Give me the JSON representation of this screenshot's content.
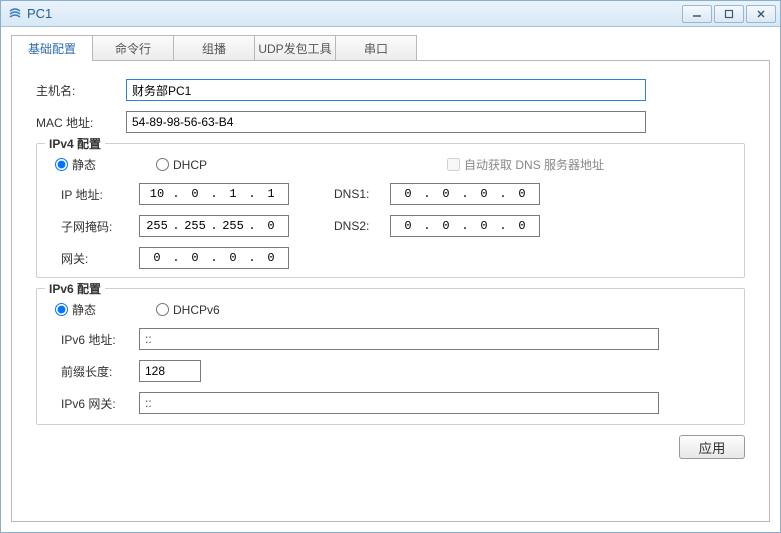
{
  "window": {
    "title": "PC1"
  },
  "tabs": [
    "基础配置",
    "命令行",
    "组播",
    "UDP发包工具",
    "串口"
  ],
  "basic": {
    "hostname_label": "主机名:",
    "hostname_value": "财务部PC1",
    "mac_label": "MAC 地址:",
    "mac_value": "54-89-98-56-63-B4"
  },
  "ipv4": {
    "legend": "IPv4 配置",
    "static_label": "静态",
    "dhcp_label": "DHCP",
    "auto_dns_label": "自动获取 DNS 服务器地址",
    "ip_label": "IP 地址:",
    "ip": [
      "10",
      "0",
      "1",
      "1"
    ],
    "mask_label": "子网掩码:",
    "mask": [
      "255",
      "255",
      "255",
      "0"
    ],
    "gw_label": "网关:",
    "gw": [
      "0",
      "0",
      "0",
      "0"
    ],
    "dns1_label": "DNS1:",
    "dns1": [
      "0",
      "0",
      "0",
      "0"
    ],
    "dns2_label": "DNS2:",
    "dns2": [
      "0",
      "0",
      "0",
      "0"
    ]
  },
  "ipv6": {
    "legend": "IPv6 配置",
    "static_label": "静态",
    "dhcp_label": "DHCPv6",
    "addr_label": "IPv6 地址:",
    "addr_value": "::",
    "prefix_label": "前缀长度:",
    "prefix_value": "128",
    "gw_label": "IPv6 网关:",
    "gw_value": "::"
  },
  "footer": {
    "apply": "应用"
  }
}
